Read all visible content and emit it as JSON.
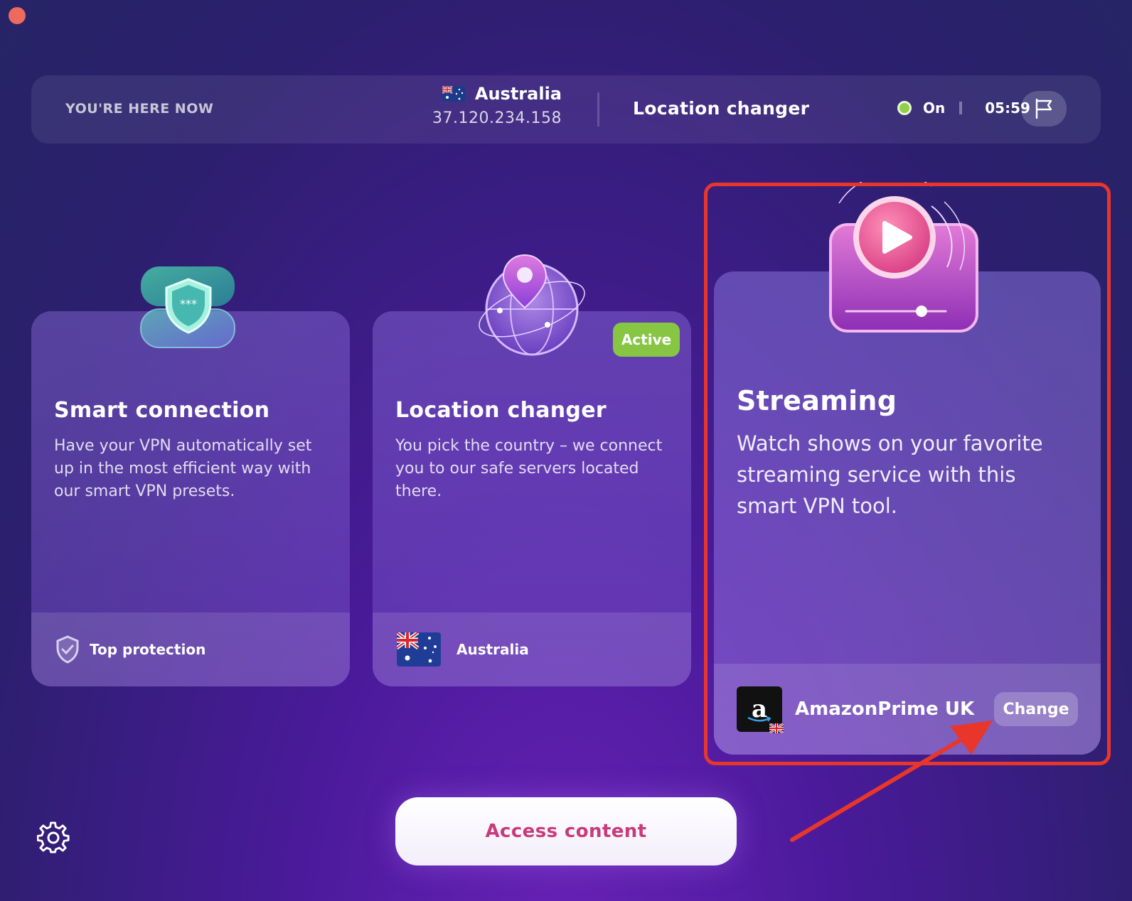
{
  "window": {
    "close_color": "#ec6a5e"
  },
  "topbar": {
    "here_label": "YOU'RE HERE NOW",
    "country": "Australia",
    "ip": "37.120.234.158",
    "feature": "Location changer",
    "status": "On",
    "status_color": "#8fd14a",
    "timer": "05:59"
  },
  "cards": [
    {
      "title": "Smart connection",
      "description": "Have your VPN automatically set up in the most efficient way with our smart VPN presets.",
      "footer_label": "Top protection",
      "footer_icon": "shield-check-icon"
    },
    {
      "title": "Location changer",
      "description": "You pick the country – we connect you to our safe servers located there.",
      "badge": "Active",
      "badge_color": "#86c642",
      "footer_label": "Australia",
      "footer_icon": "australia-flag-icon"
    }
  ],
  "streaming": {
    "title": "Streaming",
    "description": "Watch shows on your favorite streaming service with this smart VPN tool.",
    "service": "AmazonPrime UK",
    "service_logo": "a",
    "change_label": "Change"
  },
  "annotation": {
    "color": "#e8362b"
  },
  "access_button": "Access content"
}
